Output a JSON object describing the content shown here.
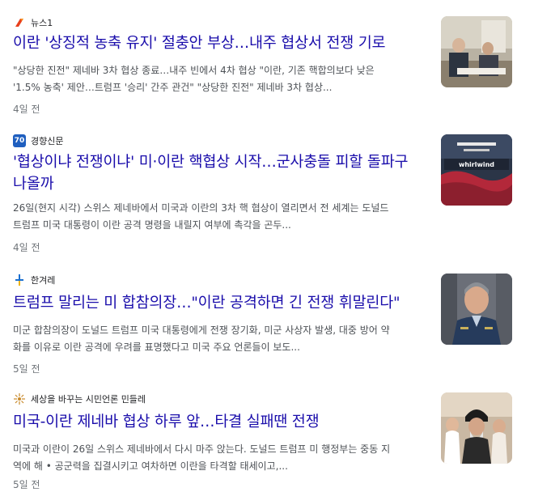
{
  "articles": [
    {
      "source": "뉴스1",
      "title": "이란 '상징적 농축 유지' 절충안 부상…내주 협상서 전쟁 기로",
      "snippet_line1": "\"상당한 진전\" 제네바 3차 협상 종료…내주 빈에서 4차 협상 \"이란, 기존 핵합의보다 낮은",
      "snippet_line2": "'1.5% 농축' 제안…트럼프 '승리' 간주 관건\" \"상당한 진전\" 제네바 3차 협상...",
      "age": "4일 전",
      "logo_color": "#e8401c"
    },
    {
      "source": "경향신문",
      "title_line1": "'협상이냐 전쟁이냐' 미·이란 핵협상 시작…군사충돌 피할 돌파구",
      "title_line2": "나올까",
      "snippet_line1": "26일(현지 시각) 스위스 제네바에서 미국과 이란의 3차 핵 협상이 열리면서 전 세계는 도널드",
      "snippet_line2": "트럼프 미국 대통령이 이란 공격 명령을 내릴지 여부에 촉각을 곤두...",
      "age": "4일 전",
      "logo_color": "#1f5fbf",
      "logo_text": "70",
      "thumb_text1": "whirlwind"
    },
    {
      "source": "한겨레",
      "title": "트럼프 말리는 미 합참의장…\"이란 공격하면 긴 전쟁 휘말린다\"",
      "snippet_line1": "미군 합참의장이 도널드 트럼프 미국 대통령에게 전쟁 장기화, 미군 사상자 발생, 대중 방어 약",
      "snippet_line2": "화를 이유로 이란 공격에 우려를 표명했다고 미국 주요 언론들이 보도...",
      "age": "5일 전",
      "logo_color": "#1a6fd0"
    },
    {
      "source": "세상을 바꾸는 시민언론 민들레",
      "title": "미국-이란 제네바 협상 하루 앞…타결 실패땐 전쟁",
      "snippet_line1": "미국과 이란이 26일 스위스 제네바에서 다시 마주 앉는다. 도널드 트럼프 미 행정부는 중동 지",
      "snippet_line2": "역에 해 • 공군력을 집결시키고 여차하면 이란을 타격할 태세이고,...",
      "age": "5일 전",
      "logo_color": "#c98a2b"
    }
  ]
}
